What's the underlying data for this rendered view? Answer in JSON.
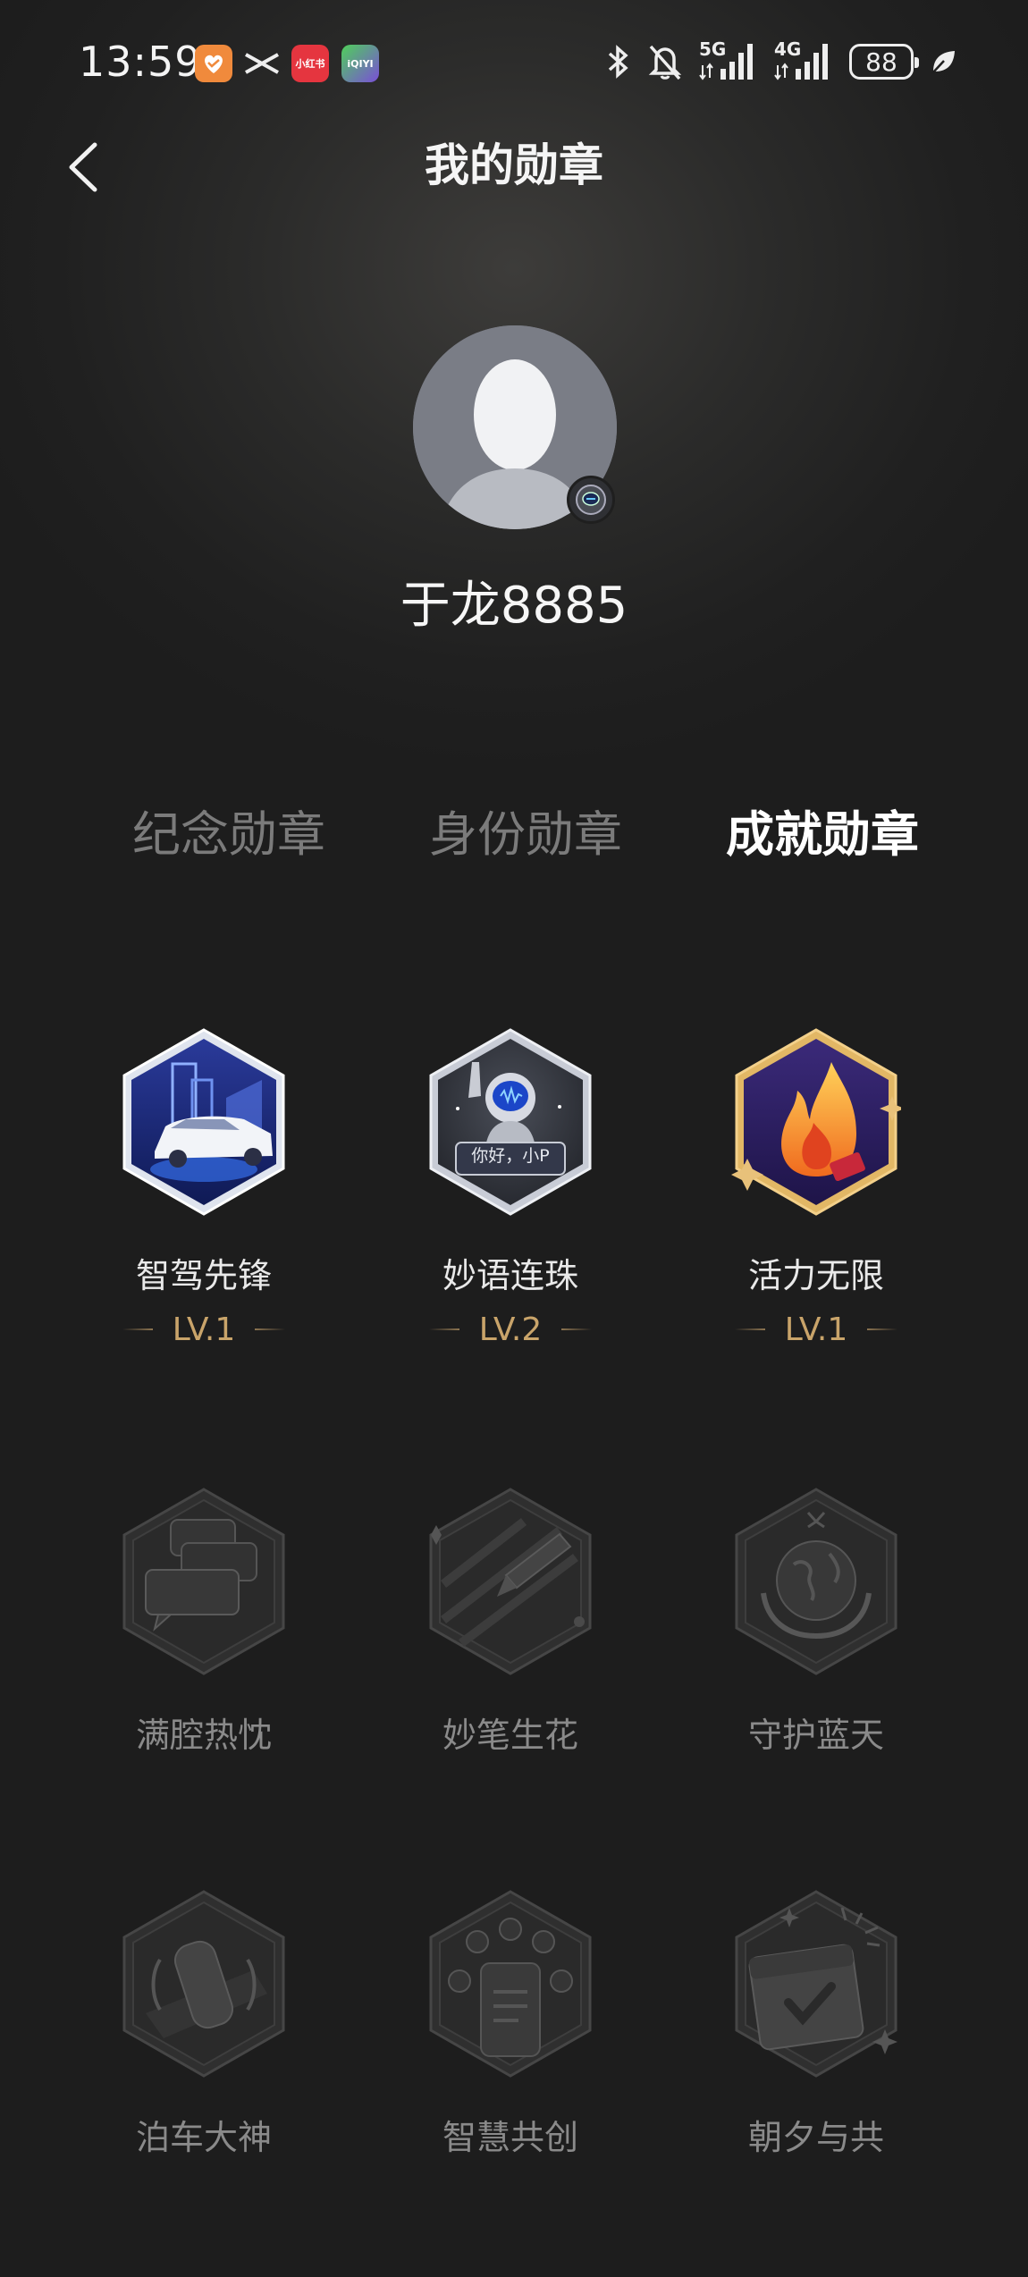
{
  "status_bar": {
    "time": "13:59",
    "apps": [
      "health-app-icon",
      "xpeng-app-icon",
      "xiaohongshu-app-icon",
      "iqiyi-app-icon"
    ],
    "xiaohongshu_label": "小红书",
    "iqiyi_label": "iQIYI",
    "signal_1": "5G",
    "signal_2": "4G",
    "battery": "88"
  },
  "header": {
    "title": "我的勋章"
  },
  "profile": {
    "username": "于龙8885"
  },
  "tabs": [
    {
      "label": "纪念勋章",
      "active": false
    },
    {
      "label": "身份勋章",
      "active": false
    },
    {
      "label": "成就勋章",
      "active": true
    }
  ],
  "medals": [
    {
      "name": "智驾先锋",
      "level": "LV.1",
      "unlocked": true,
      "icon": "car-city-medal-icon"
    },
    {
      "name": "妙语连珠",
      "level": "LV.2",
      "unlocked": true,
      "icon": "astronaut-voice-medal-icon",
      "bubble": "你好，小P"
    },
    {
      "name": "活力无限",
      "level": "LV.1",
      "unlocked": true,
      "icon": "flame-medal-icon"
    },
    {
      "name": "满腔热忱",
      "unlocked": false,
      "icon": "chat-bubbles-medal-icon"
    },
    {
      "name": "妙笔生花",
      "unlocked": false,
      "icon": "pen-medal-icon"
    },
    {
      "name": "守护蓝天",
      "unlocked": false,
      "icon": "earth-hands-medal-icon"
    },
    {
      "name": "泊车大神",
      "unlocked": false,
      "icon": "parking-car-medal-icon"
    },
    {
      "name": "智慧共创",
      "unlocked": false,
      "icon": "phone-apps-medal-icon"
    },
    {
      "name": "朝夕与共",
      "unlocked": false,
      "icon": "calendar-check-medal-icon"
    }
  ],
  "colors": {
    "background": "#1e1e1e",
    "level_gold": "#c9a46a",
    "tab_inactive": "#7b7b7b",
    "tab_active": "#ffffff"
  }
}
